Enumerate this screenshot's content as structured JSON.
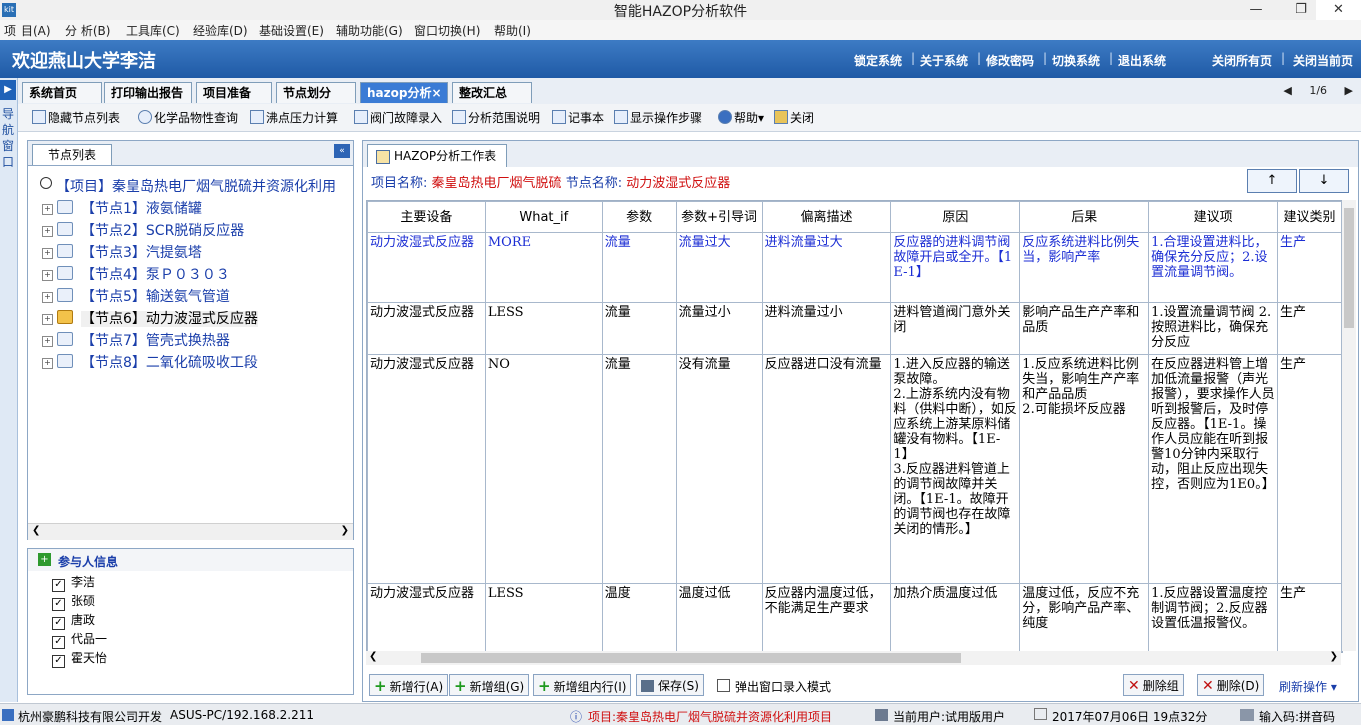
{
  "window": {
    "title": "智能HAZOP分析软件",
    "icon_text": "kit"
  },
  "menu": [
    "项",
    "目(A)",
    "分 析(B)",
    "工具库(C)",
    "经验库(D)",
    "基础设置(E)",
    "辅助功能(G)",
    "窗口切换(H)",
    "帮助(I)"
  ],
  "banner": {
    "welcome": "欢迎燕山大学李洁",
    "links": [
      "锁定系统",
      "关于系统",
      "修改密码",
      "切换系统",
      "退出系统"
    ],
    "right_links": [
      "关闭所有页",
      "关闭当前页"
    ]
  },
  "nav_strip": {
    "label": "导航窗口"
  },
  "tabs": [
    {
      "label": "系统首页"
    },
    {
      "label": "打印输出报告"
    },
    {
      "label": "项目准备"
    },
    {
      "label": "节点划分"
    },
    {
      "label": "hazop分析×"
    },
    {
      "label": "整改汇总"
    }
  ],
  "pager": "1/6",
  "toolbar": [
    "隐藏节点列表",
    "化学品物性查询",
    "沸点压力计算",
    "阀门故障录入",
    "分析范围说明",
    "记事本",
    "显示操作步骤",
    "帮助",
    "关闭"
  ],
  "node_panel": {
    "tab": "节点列表",
    "project": "【项目】秦皇岛热电厂烟气脱硫并资源化利用",
    "nodes": [
      {
        "label": "【节点1】液氨储罐"
      },
      {
        "label": "【节点2】SCR脱硝反应器"
      },
      {
        "label": "【节点3】汽提氨塔"
      },
      {
        "label": "【节点4】泵Ｐ０３０３"
      },
      {
        "label": "【节点5】输送氨气管道"
      },
      {
        "label": "【节点6】动力波湿式反应器"
      },
      {
        "label": "【节点7】管壳式换热器"
      },
      {
        "label": "【节点8】二氧化硫吸收工段"
      }
    ],
    "selected_index": 5
  },
  "participants": {
    "title": "参与人信息",
    "people": [
      "李洁",
      "张硕",
      "唐政",
      "代品一",
      "霍天怡"
    ]
  },
  "worksheet": {
    "tab": "HAZOP分析工作表",
    "project_label": "项目名称:",
    "project_value": "秦皇岛热电厂烟气脱硫",
    "node_label": "节点名称:",
    "node_value": "动力波湿式反应器",
    "up": "↑",
    "down": "↓",
    "columns": [
      "主要设备",
      "What_if",
      "参数",
      "参数+引导词",
      "偏离描述",
      "原因",
      "后果",
      "建议项",
      "建议类别"
    ],
    "rows": [
      [
        "动力波湿式反应器",
        "MORE",
        "流量",
        "流量过大",
        "进料流量过大",
        "反应器的进料调节阀故障开启或全开。【1E-1】",
        "反应系统进料比例失当，影响产率",
        "1.合理设置进料比，确保充分反应；2.设置流量调节阀。",
        "生产"
      ],
      [
        "动力波湿式反应器",
        "LESS",
        "流量",
        "流量过小",
        "进料流量过小",
        "进料管道阀门意外关闭",
        "影响产品生产产率和品质",
        "1.设置流量调节阀 2.按照进料比，确保充分反应",
        "生产"
      ],
      [
        "动力波湿式反应器",
        "NO",
        "流量",
        "没有流量",
        "反应器进口没有流量",
        "1.进入反应器的输送泵故障。\n2.上游系统内没有物料（供料中断），如反应系统上游某原料储罐没有物料。【1E-1】\n3.反应器进料管道上的调节阀故障并关闭。【1E-1。故障开的调节阀也存在故障关闭的情形。】",
        "1.反应系统进料比例失当，影响生产产率和产品品质\n2.可能损坏反应器",
        "在反应器进料管上增加低流量报警（声光报警），要求操作人员听到报警后，及时停反应器。【1E-1。操作人员应能在听到报警10分钟内采取行动，阻止反应出现失控，否则应为1E0。】",
        "生产"
      ],
      [
        "动力波湿式反应器",
        "LESS",
        "温度",
        "温度过低",
        "反应器内温度过低，不能满足生产要求",
        "加热介质温度过低",
        "温度过低，反应不充分，影响产品产率、纯度",
        "1.反应器设置温度控制调节阀；2.反应器设置低温报警仪。",
        "生产"
      ]
    ]
  },
  "bottom_buttons": {
    "add_row": "新增行(A)",
    "add_group": "新增组(G)",
    "add_in_group": "新增组内行(I)",
    "save": "保存(S)",
    "popup_mode": "弹出窗口录入模式",
    "delete_group": "删除组",
    "delete": "删除(D)",
    "refresh": "刷新操作"
  },
  "status": {
    "company": "杭州豪鹏科技有限公司开发",
    "host": "ASUS-PC/192.168.2.211",
    "project": "项目:秦皇岛热电厂烟气脱硫并资源化利用项目",
    "user": "当前用户:试用版用户",
    "datetime": "2017年07月06日 19点32分",
    "ime": "输入码:拼音码"
  }
}
